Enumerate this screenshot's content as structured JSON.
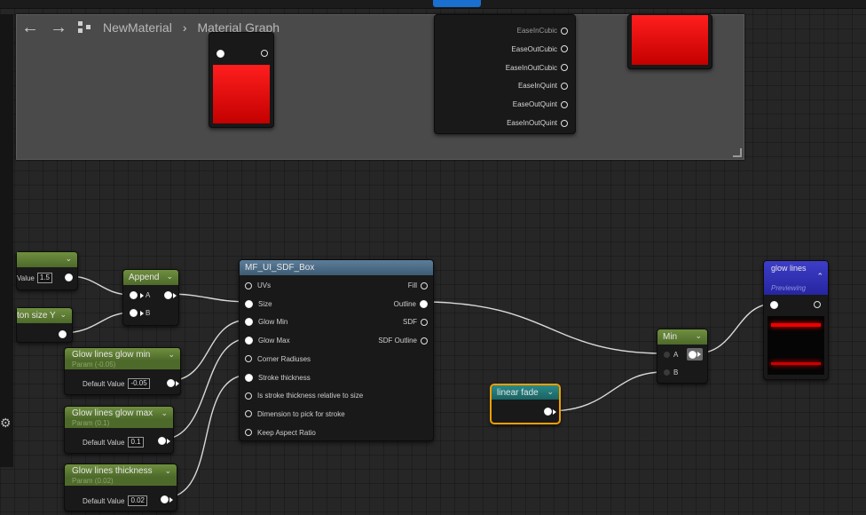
{
  "breadcrumb": {
    "asset": "NewMaterial",
    "graph": "Material Graph"
  },
  "ease_outputs": [
    "EaseInCubic",
    "EaseOutCubic",
    "EaseInOutCubic",
    "EaseInQuint",
    "EaseOutQuint",
    "EaseInOutQuint"
  ],
  "value_node": {
    "label": "Value",
    "value": "1.5"
  },
  "param_y_node": {
    "label": "ton size Y"
  },
  "append_node": {
    "title": "Append",
    "pin_a": "A",
    "pin_b": "B"
  },
  "sdf_box_node": {
    "title": "MF_UI_SDF_Box",
    "inputs": [
      "UVs",
      "Size",
      "Glow Min",
      "Glow Max",
      "Corner Radiuses",
      "Stroke thickness",
      "Is stroke thickness relative to size",
      "Dimension to pick for stroke",
      "Keep Aspect Ratio"
    ],
    "outputs": [
      "Fill",
      "Outline",
      "SDF",
      "SDF Outline"
    ]
  },
  "glow_min_node": {
    "title": "Glow lines glow min",
    "subtitle": "Param (-0.05)",
    "default_label": "Default Value",
    "value": "-0.05"
  },
  "glow_max_node": {
    "title": "Glow lines glow max",
    "subtitle": "Param (0.1)",
    "default_label": "Default Value",
    "value": "0.1"
  },
  "glow_thick_node": {
    "title": "Glow lines thickness",
    "subtitle": "Param (0.02)",
    "default_label": "Default Value",
    "value": "0.02"
  },
  "linear_fade_node": {
    "title": "linear fade"
  },
  "min_node": {
    "title": "Min",
    "pin_a": "A",
    "pin_b": "B"
  },
  "glow_lines_node": {
    "title": "glow lines",
    "subtitle": "Previewing"
  },
  "colors": {
    "param_header": "#5d7d36",
    "function_header": "#4d6d88",
    "named_reroute": "#1f7373",
    "preview_header": "#2f2fb8",
    "selection": "#f0a000"
  }
}
